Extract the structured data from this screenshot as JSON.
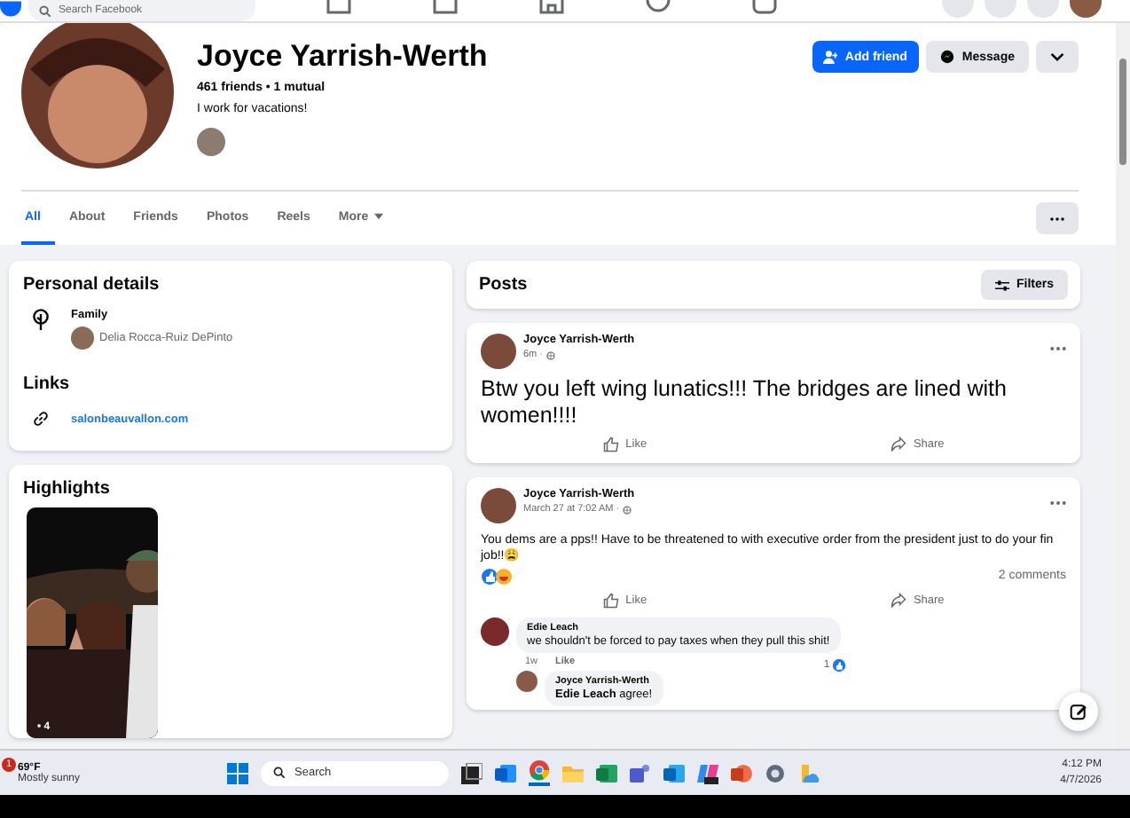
{
  "top_bar": {
    "search_placeholder": "Search Facebook"
  },
  "profile": {
    "name": "Joyce Yarrish-Werth",
    "friends": "461 friends • 1 mutual",
    "bio": "I work for vacations!",
    "actions": [
      {
        "kind": "primary",
        "label": "Add friend"
      },
      {
        "kind": "secondary",
        "label": "Message"
      },
      {
        "kind": "more"
      }
    ]
  },
  "tabs": [
    {
      "label": "All",
      "selected": true
    },
    {
      "label": "About",
      "selected": false
    },
    {
      "label": "Friends",
      "selected": false
    },
    {
      "label": "Photos",
      "selected": false
    },
    {
      "label": "Reels",
      "selected": false
    },
    {
      "label": "More",
      "selected": false
    }
  ],
  "personal_details": {
    "title": "Personal details",
    "family_label": "Family",
    "family_member": "Delia Rocca-Ruiz DePinto"
  },
  "links": {
    "title": "Links",
    "url": "salonbeauvallon.com"
  },
  "highlights": {
    "title": "Highlights",
    "count": "• 4"
  },
  "posts_header": {
    "title": "Posts",
    "filters": "Filters"
  },
  "posts": [
    {
      "kind": "big_text",
      "author": "Joyce Yarrish-Werth",
      "time": "6m ·",
      "text": "Btw you left wing lunatics!!! The bridges are lined with women!!!!",
      "like": "Like",
      "share": "Share"
    },
    {
      "kind": "text",
      "author": "Joyce Yarrish-Werth",
      "time": "March 27 at 7:02 AM ·",
      "text": "You dems are a pps!! Have to be threatened to with executive order from the president just to do your fin job!!😩",
      "comments_count": "2 comments",
      "like": "Like",
      "share": "Share",
      "comments": [
        {
          "author": "Edie Leach",
          "text": "we shouldn't be forced to pay taxes when they pull this shit!",
          "time": "1w",
          "like": "Like",
          "likes": "1",
          "replies": [
            {
              "author": "Joyce Yarrish-Werth",
              "mention": "Edie Leach",
              "text": "agree!"
            }
          ]
        }
      ]
    }
  ],
  "taskbar": {
    "weather_badge": "1",
    "temperature": "69°F",
    "weather": "Mostly sunny",
    "search": "Search",
    "time": "4:12 PM",
    "date": "4/7/2026"
  }
}
